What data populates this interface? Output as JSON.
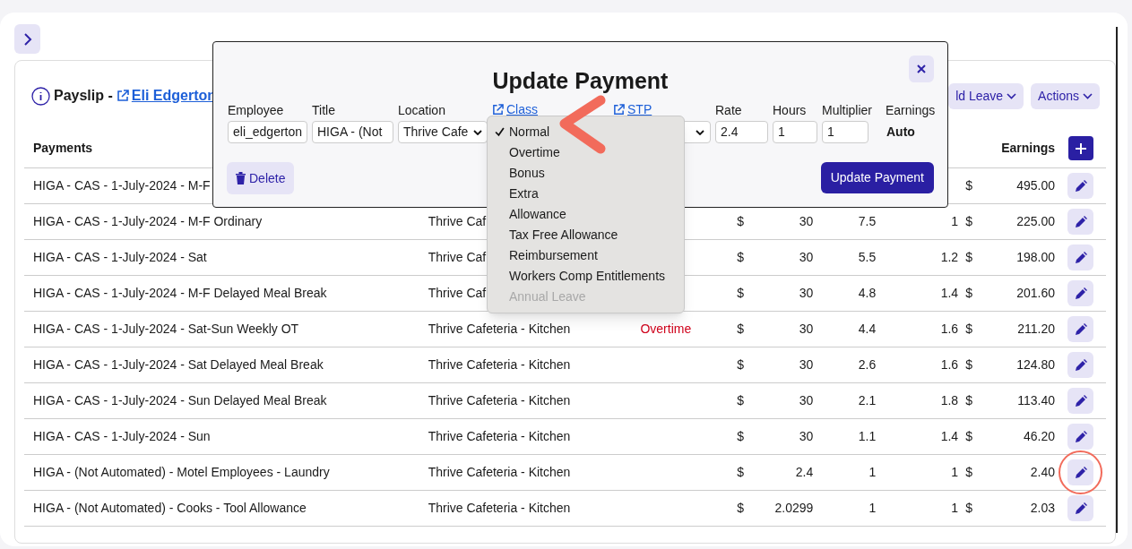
{
  "payslip": {
    "title": "Payslip -",
    "employee_link": "Eli Edgerton",
    "buttons": [
      {
        "label": "ld Leave"
      },
      {
        "label": "Actions"
      }
    ]
  },
  "table": {
    "columns": [
      "Payments",
      "Earnings"
    ],
    "rows": [
      {
        "payment": "HIGA - CAS - 1-July-2024 - M-F",
        "currency_2": "$",
        "earnings": "495.00",
        "circled": false
      },
      {
        "payment": "HIGA - CAS - 1-July-2024 - M-F Ordinary",
        "location": "Thrive Caf",
        "currency": "$",
        "rate": "30",
        "hours": "7.5",
        "multiplier": "1",
        "currency_2": "$",
        "earnings": "225.00",
        "circled": false
      },
      {
        "payment": "HIGA - CAS - 1-July-2024 - Sat",
        "location": "Thrive Caf",
        "currency": "$",
        "rate": "30",
        "hours": "5.5",
        "multiplier": "1.2",
        "currency_2": "$",
        "earnings": "198.00",
        "circled": false
      },
      {
        "payment": "HIGA - CAS - 1-July-2024 - M-F Delayed Meal Break",
        "location": "Thrive Caf",
        "currency": "$",
        "rate": "30",
        "hours": "4.8",
        "multiplier": "1.4",
        "currency_2": "$",
        "earnings": "201.60",
        "circled": false
      },
      {
        "payment": "HIGA - CAS - 1-July-2024 - Sat-Sun Weekly OT",
        "location": "Thrive Cafeteria - Kitchen",
        "class": "Overtime",
        "currency": "$",
        "rate": "30",
        "hours": "4.4",
        "multiplier": "1.6",
        "currency_2": "$",
        "earnings": "211.20",
        "circled": false
      },
      {
        "payment": "HIGA - CAS - 1-July-2024 - Sat Delayed Meal Break",
        "location": "Thrive Cafeteria - Kitchen",
        "currency": "$",
        "rate": "30",
        "hours": "2.6",
        "multiplier": "1.6",
        "currency_2": "$",
        "earnings": "124.80",
        "circled": false
      },
      {
        "payment": "HIGA - CAS - 1-July-2024 - Sun Delayed Meal Break",
        "location": "Thrive Cafeteria - Kitchen",
        "currency": "$",
        "rate": "30",
        "hours": "2.1",
        "multiplier": "1.8",
        "currency_2": "$",
        "earnings": "113.40",
        "circled": false
      },
      {
        "payment": "HIGA - CAS - 1-July-2024 - Sun",
        "location": "Thrive Cafeteria - Kitchen",
        "currency": "$",
        "rate": "30",
        "hours": "1.1",
        "multiplier": "1.4",
        "currency_2": "$",
        "earnings": "46.20",
        "circled": false
      },
      {
        "payment": "HIGA - (Not Automated) - Motel Employees - Laundry",
        "location": "Thrive Cafeteria - Kitchen",
        "currency": "$",
        "rate": "2.4",
        "hours": "1",
        "multiplier": "1",
        "currency_2": "$",
        "earnings": "2.40",
        "circled": true
      },
      {
        "payment": "HIGA - (Not Automated) - Cooks - Tool Allowance",
        "location": "Thrive Cafeteria - Kitchen",
        "currency": "$",
        "rate": "2.0299",
        "hours": "1",
        "multiplier": "1",
        "currency_2": "$",
        "earnings": "2.03",
        "circled": false
      }
    ]
  },
  "modal": {
    "title": "Update Payment",
    "fields": [
      {
        "kind": "input",
        "label": "Employee",
        "value": "eli_edgerton"
      },
      {
        "kind": "input",
        "label": "Title",
        "value": "HIGA - (Not"
      },
      {
        "kind": "select",
        "label": "Location",
        "value": "Thrive Cafe"
      },
      {
        "kind": "link",
        "label": "Class"
      },
      {
        "kind": "link-select",
        "label": "STP"
      },
      {
        "kind": "input",
        "label": "Rate",
        "value": "2.4"
      },
      {
        "kind": "input",
        "label": "Hours",
        "value": "1"
      },
      {
        "kind": "input",
        "label": "Multiplier",
        "value": "1"
      },
      {
        "kind": "static",
        "label": "Earnings",
        "value": "Auto"
      }
    ],
    "dropdown": [
      {
        "label": "Normal",
        "selected": true,
        "disabled": false
      },
      {
        "label": "Overtime",
        "selected": false,
        "disabled": false
      },
      {
        "label": "Bonus",
        "selected": false,
        "disabled": false
      },
      {
        "label": "Extra",
        "selected": false,
        "disabled": false
      },
      {
        "label": "Allowance",
        "selected": false,
        "disabled": false
      },
      {
        "label": "Tax Free Allowance",
        "selected": false,
        "disabled": false
      },
      {
        "label": "Reimbursement",
        "selected": false,
        "disabled": false
      },
      {
        "label": "Workers Comp Entitlements",
        "selected": false,
        "disabled": false
      },
      {
        "label": "Annual Leave",
        "selected": false,
        "disabled": true
      }
    ],
    "delete_button": "Delete",
    "submit_button": "Update Payment"
  }
}
